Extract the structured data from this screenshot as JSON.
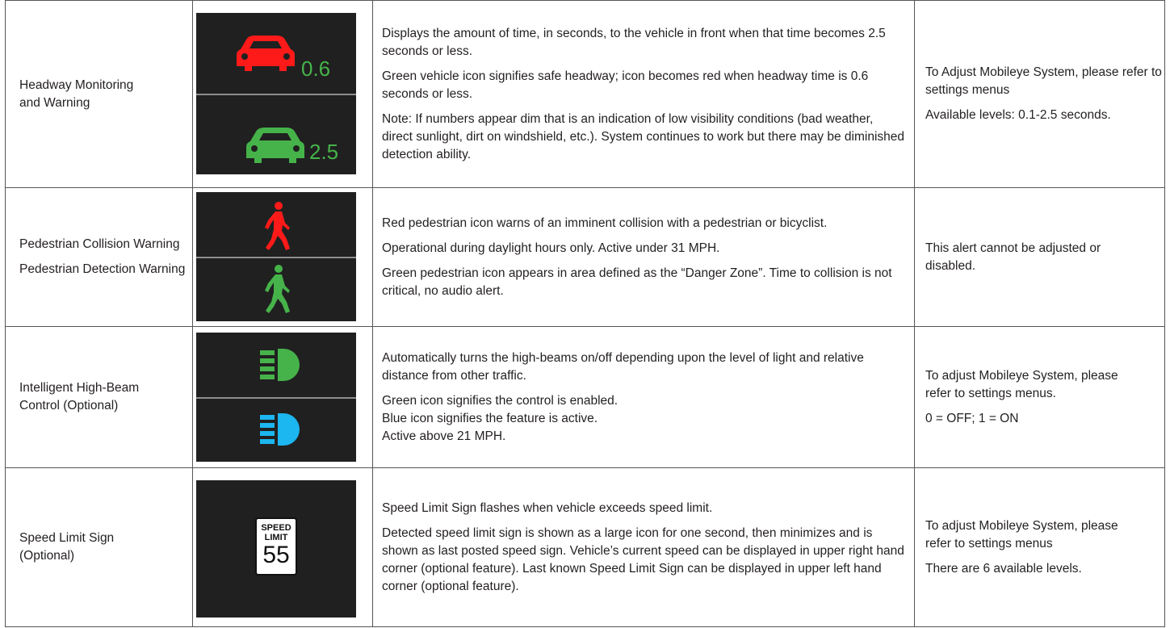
{
  "rows": [
    {
      "feature_lines": [
        "Headway Monitoring",
        "and Warning"
      ],
      "description": [
        "Displays the amount of time, in seconds, to the vehicle in front when that time becomes 2.5 seconds or less.",
        "Green vehicle icon signifies safe headway; icon becomes red when headway time is 0.6 seconds or less.",
        "Note: If numbers appear dim that is an indication of low visibility conditions (bad weather, direct sunlight, dirt on windshield, etc.). System continues to work but there may be diminished detection ability."
      ],
      "adjust": [
        "To Adjust Mobileye System, please refer to settings menus",
        "Available levels: 0.1-2.5 seconds."
      ],
      "icons": {
        "top": "red-car-icon",
        "top_value": "0.6",
        "bottom": "green-car-icon",
        "bottom_value": "2.5"
      }
    },
    {
      "feature_lines": [
        "Pedestrian Collision Warning",
        "Pedestrian Detection Warning"
      ],
      "description": [
        "Red pedestrian icon warns of an imminent collision with a pedestrian or bicyclist.",
        "Operational during daylight hours only. Active under 31 MPH.",
        "Green pedestrian icon appears in area defined as the “Danger Zone”. Time to collision is not critical, no audio alert."
      ],
      "adjust": [
        "This alert cannot be adjusted or disabled."
      ],
      "icons": {
        "top": "red-pedestrian-icon",
        "bottom": "green-pedestrian-icon"
      }
    },
    {
      "feature_lines": [
        "Intelligent High-Beam Control (Optional)"
      ],
      "description": [
        "Automatically turns the high-beams on/off depending upon the level of light and relative distance from other traffic.",
        "Green icon signifies the control is enabled.",
        "Blue icon signifies the feature is active.",
        "Active above 21 MPH."
      ],
      "adjust": [
        "To adjust Mobileye System, please refer to settings menus.",
        "0 = OFF; 1 = ON"
      ],
      "icons": {
        "top": "green-high-beam-icon",
        "bottom": "blue-high-beam-icon"
      }
    },
    {
      "feature_lines": [
        "Speed Limit Sign",
        "(Optional)"
      ],
      "description": [
        "Speed Limit Sign flashes when vehicle exceeds speed limit.",
        "Detected speed limit sign is shown as a large icon for one second, then minimizes and is shown as last posted speed sign. Vehicle’s current speed can be displayed in upper right hand corner (optional feature). Last known Speed Limit Sign can be displayed in upper left hand corner (optional feature)."
      ],
      "adjust": [
        "To adjust Mobileye System, please refer to settings menus",
        "There are 6 available levels."
      ],
      "icons": {
        "sign": "speed-limit-sign-icon",
        "sign_word1": "SPEED",
        "sign_word2": "LIMIT",
        "sign_value": "55"
      }
    }
  ],
  "colors": {
    "red": "#ff1a1a",
    "green": "#46b34a",
    "blue": "#1cb6f0",
    "icon_bg": "#202020"
  }
}
